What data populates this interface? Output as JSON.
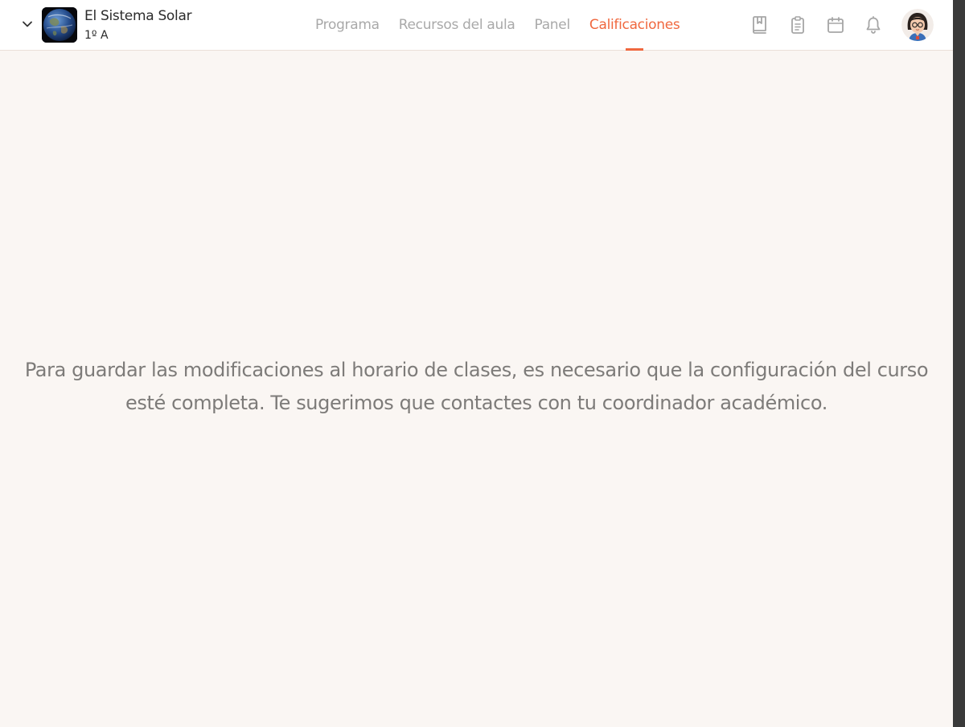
{
  "header": {
    "course_title": "El Sistema Solar",
    "course_group": "1º A",
    "tabs": [
      {
        "label": "Programa",
        "active": false
      },
      {
        "label": "Recursos del aula",
        "active": false
      },
      {
        "label": "Panel",
        "active": false
      },
      {
        "label": "Calificaciones",
        "active": true
      }
    ],
    "tools": [
      "bookmark-book-icon",
      "clipboard-icon",
      "calendar-icon",
      "bell-icon"
    ],
    "accent_color": "#f0683f"
  },
  "main": {
    "message": "Para guardar las modificaciones al horario de clases, es necesario que la configuración del curso esté completa. Te sugerimos que contactes con tu coordinador académico."
  }
}
